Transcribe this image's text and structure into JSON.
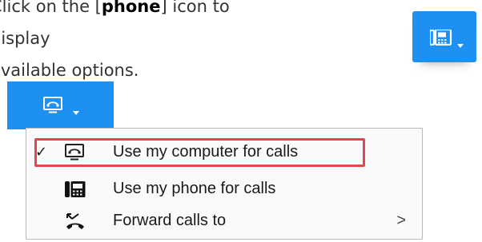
{
  "instructions": {
    "line1_prefix": "Click on the [",
    "line1_keyword": "phone",
    "line1_suffix": "] icon to display",
    "line2": "available options."
  },
  "toolbar": {
    "preview_button_icon": "desk-phone-icon",
    "mode_button_icon": "computer-audio-icon",
    "caret_icon": "chevron-down-icon",
    "accent_color": "#1e90f2"
  },
  "menu": {
    "items": [
      {
        "label": "Use my computer for calls",
        "icon": "computer-audio-icon",
        "checked": true
      },
      {
        "label": "Use my phone for calls",
        "icon": "desk-phone-icon",
        "checked": false
      },
      {
        "label": "Forward calls to",
        "icon": "call-forward-icon",
        "checked": false,
        "submenu_arrow": ">"
      }
    ],
    "check_mark": "✓",
    "highlight_color": "#e8454b"
  }
}
